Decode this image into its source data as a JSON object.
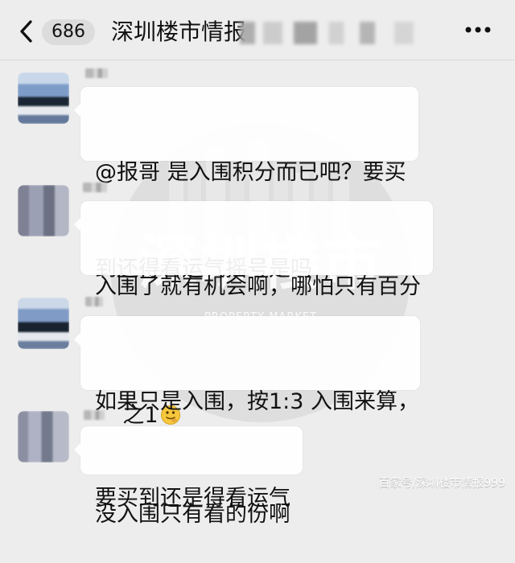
{
  "header": {
    "badge": "686",
    "title": "深圳楼市情报"
  },
  "messages": [
    {
      "line1": "@报哥 是入围积分而已吧？要买",
      "line2": "到还得看运气摇号是吗"
    },
    {
      "line1": "入围了就有机会啊，哪怕只有百分",
      "line2": "之1"
    },
    {
      "line1": "如果只是入围，按1:3 入围来算，",
      "line2": "要买到还是得看运气"
    },
    {
      "line1": "没入围只有看的份啊"
    }
  ],
  "watermark": {
    "main": "深圳楼市",
    "sub": "PROPERTY MARKET"
  },
  "footer": {
    "source": "百家号/深圳楼市情报999"
  },
  "icons": {
    "back": "back-arrow-icon",
    "more": "more-icon",
    "emoji": "thinking-face-icon"
  }
}
